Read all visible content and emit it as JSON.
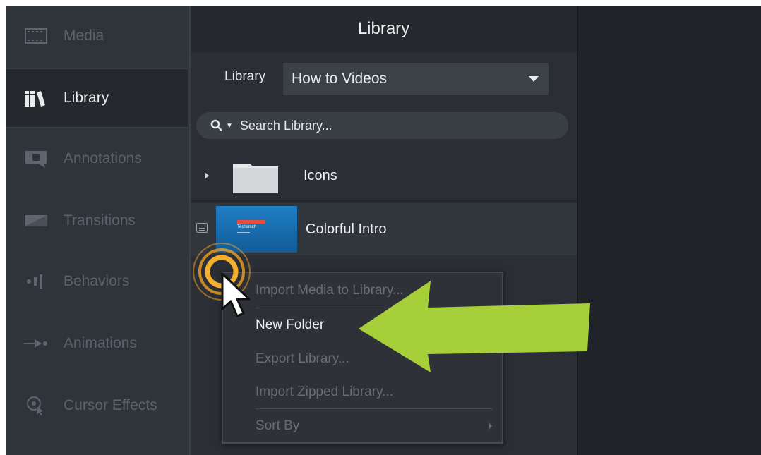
{
  "sidebar": {
    "items": [
      {
        "label": "Media",
        "icon": "film-icon",
        "active": false
      },
      {
        "label": "Library",
        "icon": "books-icon",
        "active": true
      },
      {
        "label": "Annotations",
        "icon": "annotation-icon",
        "active": false
      },
      {
        "label": "Transitions",
        "icon": "transition-icon",
        "active": false
      },
      {
        "label": "Behaviors",
        "icon": "behaviors-icon",
        "active": false
      },
      {
        "label": "Animations",
        "icon": "animation-arrow-icon",
        "active": false
      },
      {
        "label": "Cursor Effects",
        "icon": "cursor-effects-icon",
        "active": false
      }
    ]
  },
  "panel": {
    "title": "Library",
    "library_label": "Library",
    "library_selected": "How to Videos",
    "search_placeholder": "Search Library...",
    "entries": [
      {
        "label": "Icons",
        "type": "folder"
      },
      {
        "label": "Colorful Intro",
        "type": "media",
        "thumb_brand": "Techsmith"
      }
    ]
  },
  "context_menu": {
    "items": [
      {
        "label": "Import Media to Library...",
        "enabled": false
      },
      {
        "label": "New Folder",
        "enabled": true
      },
      {
        "label": "Export Library...",
        "enabled": false
      },
      {
        "label": "Import Zipped Library...",
        "enabled": false
      },
      {
        "label": "Sort By",
        "enabled": false,
        "submenu": true
      }
    ]
  },
  "colors": {
    "highlight_arrow": "#a6cf3a",
    "click_ring": "#f0a020",
    "sidebar_bg": "#2f333a",
    "panel_bg": "#2b2f35"
  }
}
